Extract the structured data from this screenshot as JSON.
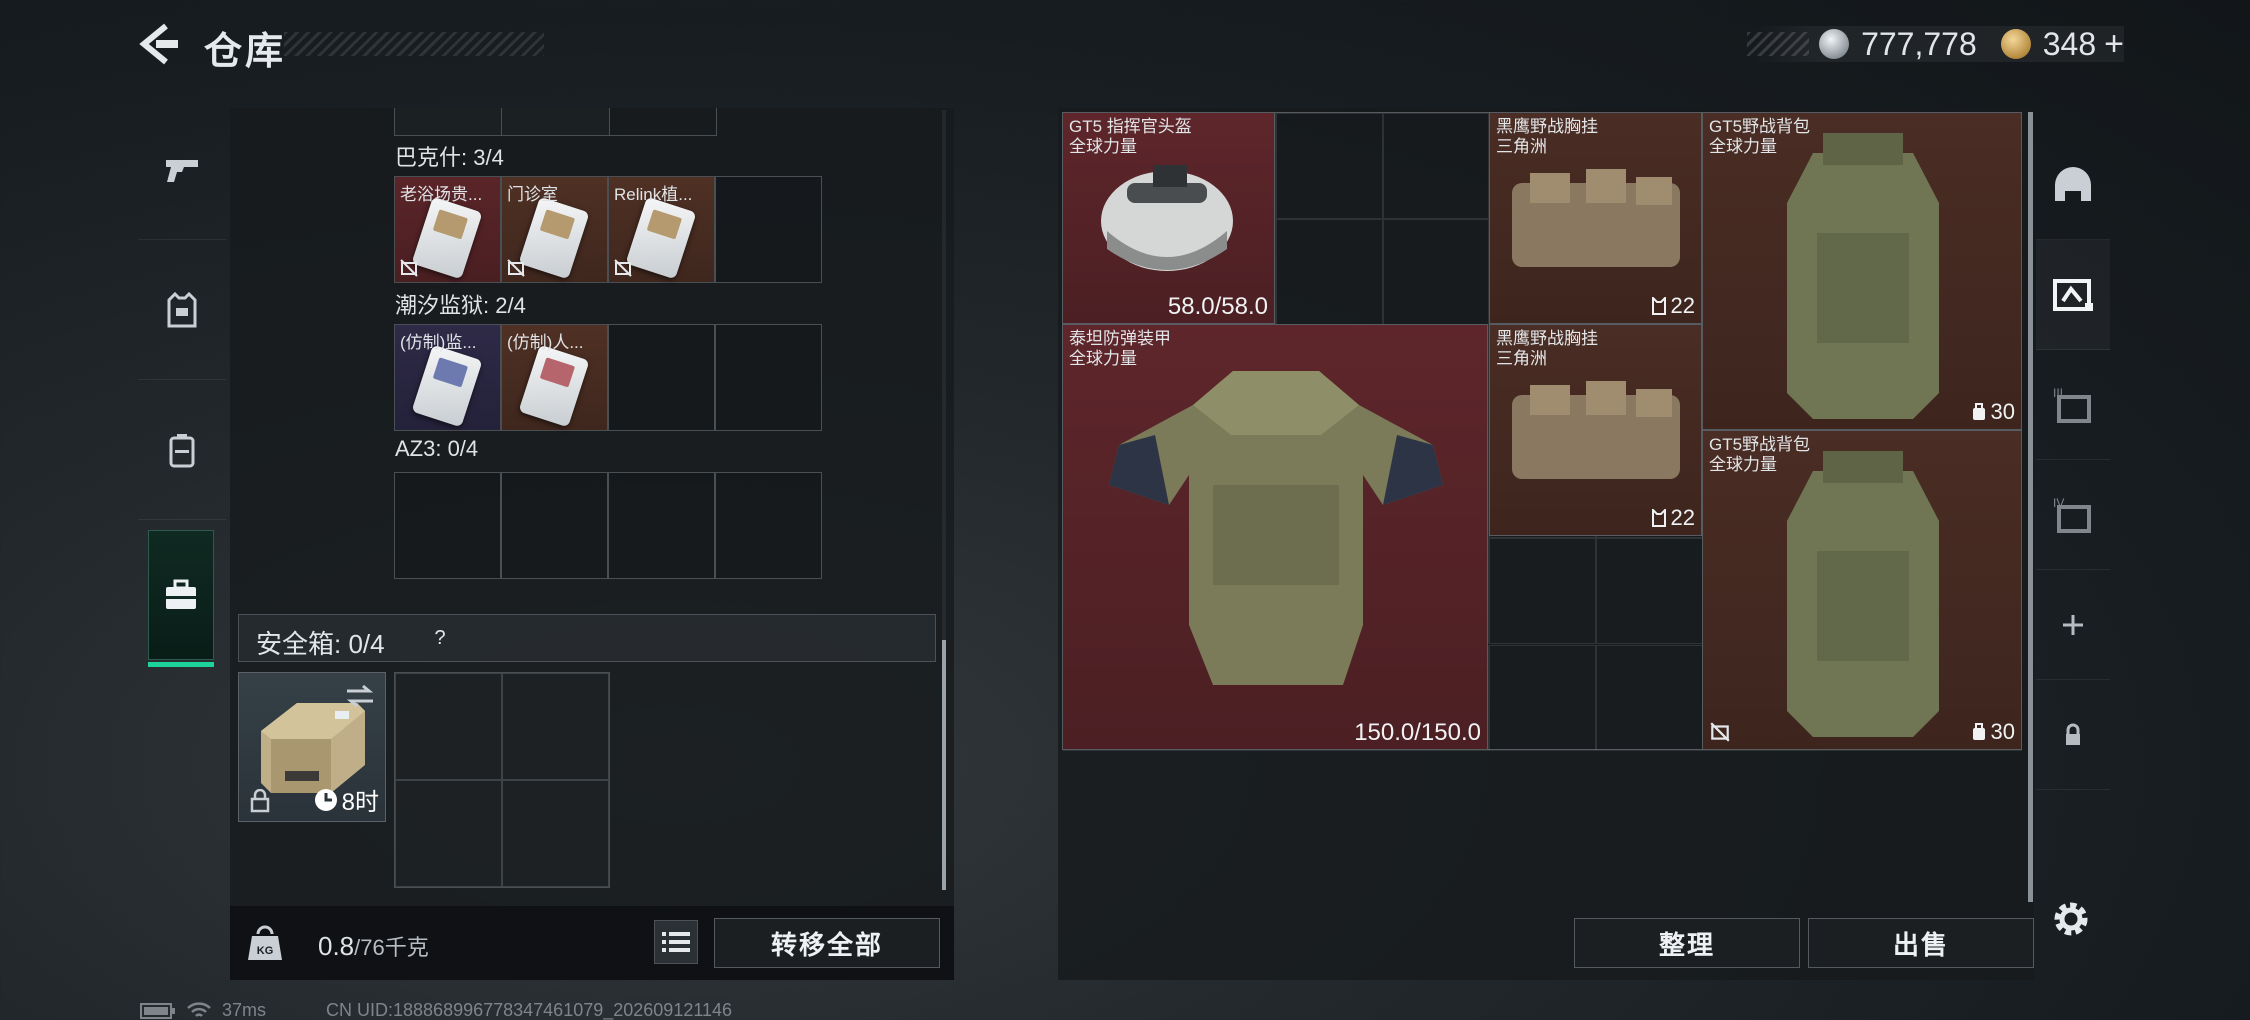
{
  "header": {
    "title": "仓库",
    "currency_silver": "777,778",
    "currency_gold": "348",
    "currency_plus": "+"
  },
  "left_tabs": [
    {
      "icon": "pistol-icon"
    },
    {
      "icon": "vest-icon"
    },
    {
      "icon": "backpack-icon"
    },
    {
      "icon": "briefcase-icon",
      "active": true
    }
  ],
  "key_groups": [
    {
      "label": "巴克什: 3/4",
      "slots": [
        {
          "name": "老浴场贵...",
          "tint": "red",
          "card": "default",
          "restricted": true
        },
        {
          "name": "门诊室",
          "tint": "brown",
          "card": "default",
          "restricted": true
        },
        {
          "name": "Relink植...",
          "tint": "brown",
          "card": "default",
          "restricted": true
        },
        {
          "name": "",
          "tint": "",
          "card": "",
          "restricted": false
        }
      ]
    },
    {
      "label": "潮汐监狱: 2/4",
      "slots": [
        {
          "name": "(仿制)监...",
          "tint": "purple",
          "card": "blue",
          "restricted": false
        },
        {
          "name": "(仿制)人...",
          "tint": "brown",
          "card": "red",
          "restricted": false
        },
        {
          "name": "",
          "tint": "",
          "card": "",
          "restricted": false
        },
        {
          "name": "",
          "tint": "",
          "card": "",
          "restricted": false
        }
      ]
    },
    {
      "label": "AZ3: 0/4",
      "slots": [
        {
          "name": "",
          "tint": "",
          "card": "",
          "restricted": false
        },
        {
          "name": "",
          "tint": "",
          "card": "",
          "restricted": false
        },
        {
          "name": "",
          "tint": "",
          "card": "",
          "restricted": false
        },
        {
          "name": "",
          "tint": "",
          "card": "",
          "restricted": false
        }
      ]
    }
  ],
  "safe_box": {
    "label": "安全箱:  0/4",
    "help": "?",
    "timer": "8时"
  },
  "footer_left": {
    "weight": "0.8",
    "weight_unit": "/76千克",
    "transfer_all": "转移全部"
  },
  "stash_items": [
    {
      "id": "helmet",
      "line1": "GT5 指挥官头盔",
      "line2": "全球力量",
      "value": "58.0/58.0",
      "tint": "red"
    },
    {
      "id": "armor",
      "line1": "泰坦防弹装甲",
      "line2": "全球力量",
      "value": "150.0/150.0",
      "tint": "red"
    },
    {
      "id": "rig1",
      "line1": "黑鹰野战胸挂",
      "line2": "三角洲",
      "value": "22",
      "tint": "brown"
    },
    {
      "id": "rig2",
      "line1": "黑鹰野战胸挂",
      "line2": "三角洲",
      "value": "22",
      "tint": "brown"
    },
    {
      "id": "pack1",
      "line1": "GT5野战背包",
      "line2": "全球力量",
      "value": "30",
      "tint": "brown"
    },
    {
      "id": "pack2",
      "line1": "GT5野战背包",
      "line2": "全球力量",
      "value": "30",
      "tint": "brown"
    }
  ],
  "footer_right": {
    "sort": "整理",
    "sell": "出售"
  },
  "right_tabs": [
    {
      "icon": "helmet-icon"
    },
    {
      "icon": "stash-page-icon",
      "active": true
    },
    {
      "icon": "stash-page-3-icon",
      "roman": "III"
    },
    {
      "icon": "stash-page-4-icon",
      "roman": "IV"
    },
    {
      "icon": "plus-icon"
    },
    {
      "icon": "lock-icon"
    }
  ],
  "status_bar": {
    "ping": "37ms",
    "uid": "CN UID:1888689967783474610​79_202609121146"
  },
  "colors": {
    "accent": "#1cd49a",
    "rare_red": "#5e262b",
    "rare_brown": "#4a2d24",
    "rare_purple": "#2e2a47"
  }
}
